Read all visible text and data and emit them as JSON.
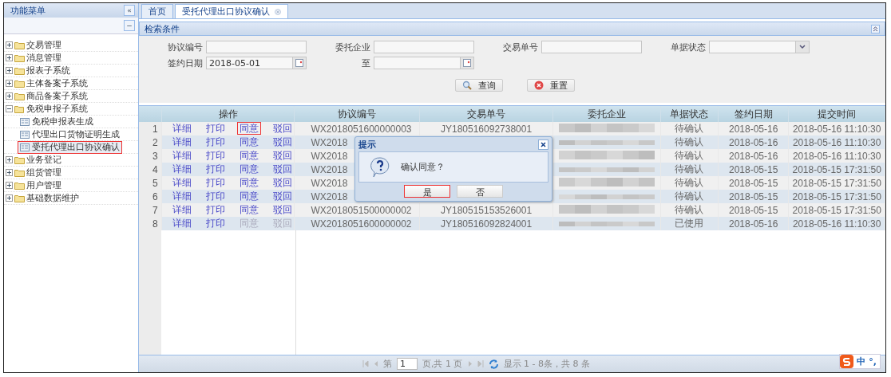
{
  "sidebar": {
    "title": "功能菜单",
    "collapse_label": "«",
    "toolbar_label": "−",
    "items": [
      {
        "label": "交易管理",
        "expanded": false
      },
      {
        "label": "消息管理",
        "expanded": false
      },
      {
        "label": "报表子系统",
        "expanded": false
      },
      {
        "label": "主体备案子系统",
        "expanded": false
      },
      {
        "label": "商品备案子系统",
        "expanded": false
      },
      {
        "label": "免税申报子系统",
        "expanded": true,
        "children": [
          {
            "label": "免税申报表生成",
            "selected": false
          },
          {
            "label": "代理出口货物证明生成",
            "selected": false
          },
          {
            "label": "受托代理出口协议确认",
            "selected": true
          }
        ]
      },
      {
        "label": "业务登记",
        "expanded": false
      },
      {
        "label": "组货管理",
        "expanded": false
      },
      {
        "label": "用户管理",
        "expanded": false
      },
      {
        "label": "基础数据维护",
        "expanded": false
      }
    ]
  },
  "tabs": [
    {
      "label": "首页",
      "selected": false,
      "closable": false
    },
    {
      "label": "受托代理出口协议确认",
      "selected": true,
      "closable": true
    }
  ],
  "search": {
    "title": "检索条件",
    "rows": [
      [
        {
          "label": "协议编号",
          "kind": "text"
        },
        {
          "label": "委托企业",
          "kind": "text"
        },
        {
          "label": "交易单号",
          "kind": "text"
        },
        {
          "label": "单据状态",
          "kind": "select"
        }
      ],
      [
        {
          "label": "签约日期",
          "kind": "date",
          "value": "2018-05-01"
        },
        {
          "label": "至",
          "kind": "date"
        }
      ]
    ],
    "buttons": [
      {
        "label": "查询",
        "kind": "search"
      },
      {
        "label": "重置",
        "kind": "reset"
      }
    ]
  },
  "grid": {
    "columns": [
      {
        "kind": "index"
      },
      {
        "label": "操作",
        "kind": "actions"
      },
      {
        "label": "协议编号",
        "kind": "text"
      },
      {
        "label": "交易单号",
        "kind": "text"
      },
      {
        "label": "委托企业",
        "kind": "redacted"
      },
      {
        "label": "单据状态",
        "kind": "text"
      },
      {
        "label": "签约日期",
        "kind": "text"
      },
      {
        "label": "提交时间",
        "kind": "text"
      }
    ],
    "rows": [
      {
        "cells": [
          "1",
          [
            {
              "label": "详细",
              "disabled": false,
              "marked": false
            },
            {
              "label": "打印",
              "disabled": false,
              "marked": false
            },
            {
              "label": "同意",
              "disabled": false,
              "marked": true
            },
            {
              "label": "驳回",
              "disabled": false,
              "marked": false
            }
          ],
          "WX2018051600000003",
          "JY180516092738001",
          null,
          "待确认",
          "2018-05-16",
          "2018-05-16 11:10:30"
        ]
      },
      {
        "cells": [
          "2",
          [
            {
              "label": "详细",
              "disabled": false,
              "marked": false
            },
            {
              "label": "打印",
              "disabled": false,
              "marked": false
            },
            {
              "label": "同意",
              "disabled": false,
              "marked": false
            },
            {
              "label": "驳回",
              "disabled": false,
              "marked": false
            }
          ],
          "WX2018",
          null,
          null,
          "待确认",
          "2018-05-16",
          "2018-05-16 11:10:30"
        ]
      },
      {
        "cells": [
          "3",
          [
            {
              "label": "详细",
              "disabled": false,
              "marked": false
            },
            {
              "label": "打印",
              "disabled": false,
              "marked": false
            },
            {
              "label": "同意",
              "disabled": false,
              "marked": false
            },
            {
              "label": "驳回",
              "disabled": false,
              "marked": false
            }
          ],
          "WX2018",
          null,
          null,
          "待确认",
          "2018-05-16",
          "2018-05-16 11:10:30"
        ]
      },
      {
        "cells": [
          "4",
          [
            {
              "label": "详细",
              "disabled": false,
              "marked": false
            },
            {
              "label": "打印",
              "disabled": false,
              "marked": false
            },
            {
              "label": "同意",
              "disabled": false,
              "marked": false
            },
            {
              "label": "驳回",
              "disabled": false,
              "marked": false
            }
          ],
          "WX2018",
          null,
          null,
          "待确认",
          "2018-05-15",
          "2018-05-15 17:31:50"
        ]
      },
      {
        "cells": [
          "5",
          [
            {
              "label": "详细",
              "disabled": false,
              "marked": false
            },
            {
              "label": "打印",
              "disabled": false,
              "marked": false
            },
            {
              "label": "同意",
              "disabled": false,
              "marked": false
            },
            {
              "label": "驳回",
              "disabled": false,
              "marked": false
            }
          ],
          "WX2018",
          null,
          null,
          "待确认",
          "2018-05-15",
          "2018-05-15 17:31:50"
        ]
      },
      {
        "cells": [
          "6",
          [
            {
              "label": "详细",
              "disabled": false,
              "marked": false
            },
            {
              "label": "打印",
              "disabled": false,
              "marked": false
            },
            {
              "label": "同意",
              "disabled": false,
              "marked": false
            },
            {
              "label": "驳回",
              "disabled": false,
              "marked": false
            }
          ],
          "WX2018",
          null,
          null,
          "待确认",
          "2018-05-15",
          "2018-05-15 17:31:50"
        ]
      },
      {
        "cells": [
          "7",
          [
            {
              "label": "详细",
              "disabled": false,
              "marked": false
            },
            {
              "label": "打印",
              "disabled": false,
              "marked": false
            },
            {
              "label": "同意",
              "disabled": false,
              "marked": false
            },
            {
              "label": "驳回",
              "disabled": false,
              "marked": false
            }
          ],
          "WX2018051500000002",
          "JY180515153526001",
          null,
          "待确认",
          "2018-05-15",
          "2018-05-15 17:31:50"
        ]
      },
      {
        "cells": [
          "8",
          [
            {
              "label": "详细",
              "disabled": false,
              "marked": false
            },
            {
              "label": "打印",
              "disabled": false,
              "marked": false
            },
            {
              "label": "同意",
              "disabled": true,
              "marked": false
            },
            {
              "label": "驳回",
              "disabled": true,
              "marked": false
            }
          ],
          "WX2018051600000002",
          "JY180516092824001",
          null,
          "已使用",
          "2018-05-16",
          "2018-05-16 11:10:30"
        ]
      }
    ]
  },
  "pager": {
    "page_prefix": "第",
    "page": "1",
    "page_suffix": "页,共 1 页",
    "summary": "显示 1 - 8条，共 8 条"
  },
  "dialog": {
    "title": "提示",
    "message": "确认同意？",
    "buttons": [
      {
        "label": "是",
        "marked": true
      },
      {
        "label": "否",
        "marked": false
      }
    ]
  },
  "ime": {
    "mode": "中",
    "punct": "°,"
  }
}
